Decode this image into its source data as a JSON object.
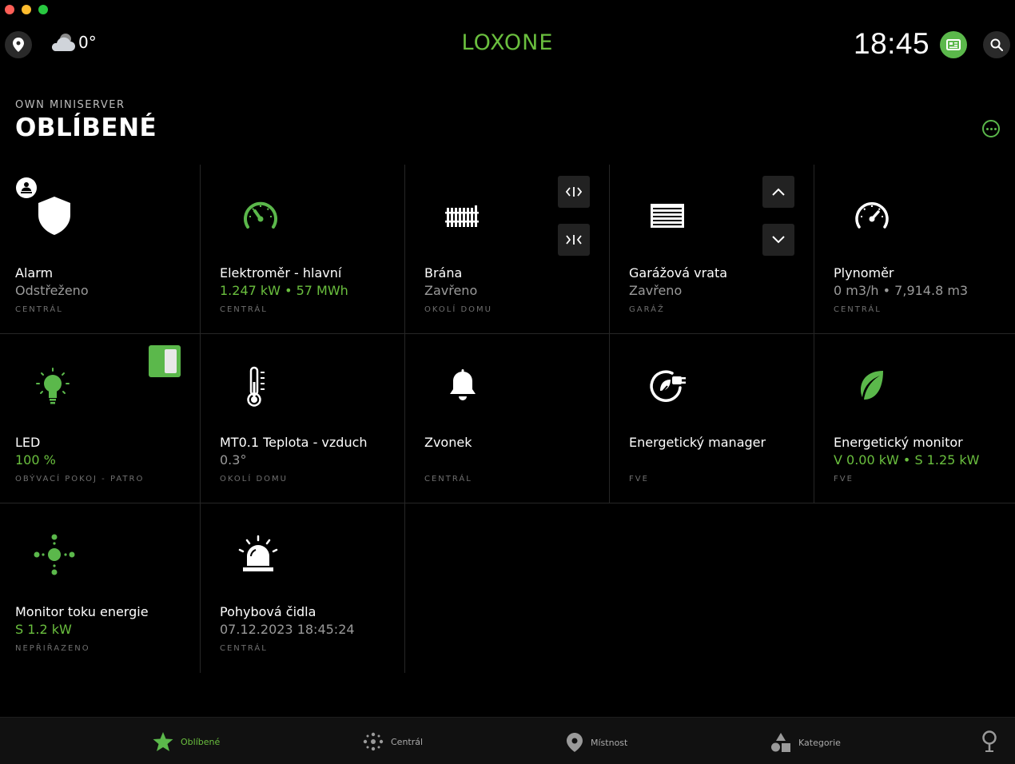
{
  "window": {
    "controls": [
      "#ff5f57",
      "#febc2e",
      "#28c840"
    ]
  },
  "header": {
    "weather_temp": "0°",
    "logo": "LOXONE",
    "clock": "18:45"
  },
  "page": {
    "subtitle": "OWN MINISERVER",
    "title": "OBLÍBENÉ"
  },
  "tiles": [
    {
      "name": "Alarm",
      "state": "Odstřeženo",
      "room": "CENTRÁL",
      "icon": "shield-icon",
      "state_color": "gray"
    },
    {
      "name": "Elektroměr - hlavní",
      "state": "1.247 kW • 57 MWh",
      "room": "CENTRÁL",
      "icon": "speedometer-icon",
      "state_color": "green"
    },
    {
      "name": "Brána",
      "state": "Zavřeno",
      "room": "OKOLÍ DOMU",
      "icon": "fence-gate-icon",
      "state_color": "gray"
    },
    {
      "name": "Garážová vrata",
      "state": "Zavřeno",
      "room": "GARÁŽ",
      "icon": "garage-door-icon",
      "state_color": "gray"
    },
    {
      "name": "Plynoměr",
      "state": "0 m3/h • 7,914.8 m3",
      "room": "CENTRÁL",
      "icon": "gauge-icon",
      "state_color": "gray"
    },
    {
      "name": "LED",
      "state": "100 %",
      "room": "OBÝVACÍ POKOJ - PATRO",
      "icon": "light-bulb-icon",
      "state_color": "green"
    },
    {
      "name": "MT0.1 Teplota - vzduch",
      "state": "0.3°",
      "room": "OKOLÍ DOMU",
      "icon": "thermometer-icon",
      "state_color": "gray"
    },
    {
      "name": "Zvonek",
      "state": "",
      "room": "CENTRÁL",
      "icon": "bell-icon",
      "state_color": "gray"
    },
    {
      "name": "Energetický manager",
      "state": "",
      "room": "FVE",
      "icon": "energy-plug-icon",
      "state_color": "gray"
    },
    {
      "name": "Energetický monitor",
      "state": "V 0.00 kW • S 1.25 kW",
      "room": "FVE",
      "icon": "leaf-icon",
      "state_color": "green"
    },
    {
      "name": "Monitor toku energie",
      "state": "S 1.2 kW",
      "room": "NEPŘIŘAZENO",
      "icon": "energy-flow-icon",
      "state_color": "green"
    },
    {
      "name": "Pohybová čidla",
      "state": "07.12.2023 18:45:24",
      "room": "CENTRÁL",
      "icon": "siren-icon",
      "state_color": "gray"
    }
  ],
  "nav": [
    {
      "label": "Oblíbené",
      "icon": "star-icon",
      "active": true
    },
    {
      "label": "Centrál",
      "icon": "dots-icon",
      "active": false
    },
    {
      "label": "Místnost",
      "icon": "pin-icon",
      "active": false
    },
    {
      "label": "Kategorie",
      "icon": "shapes-icon",
      "active": false
    }
  ],
  "colors": {
    "accent": "#6abf3e",
    "background": "#000000",
    "tile_border": "#262626"
  }
}
